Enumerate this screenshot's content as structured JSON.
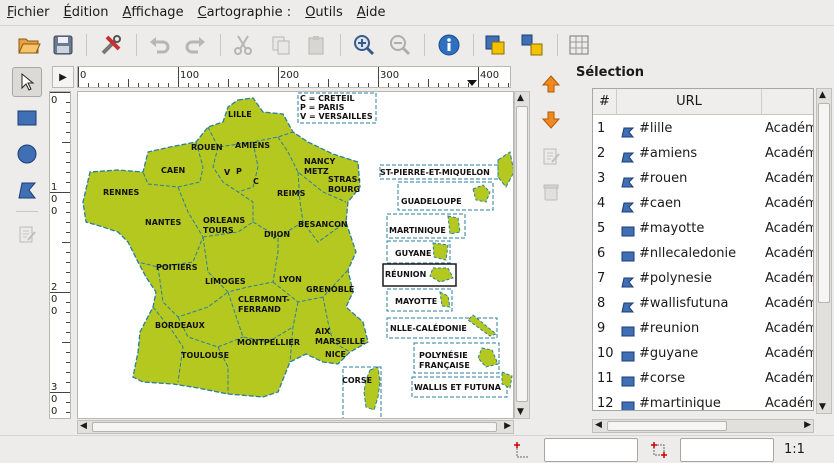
{
  "menubar": {
    "items": [
      {
        "label": "Fichier",
        "mnemonic": "F",
        "rest": "ichier"
      },
      {
        "label": "Édition",
        "mnemonic": "É",
        "rest": "dition"
      },
      {
        "label": "Affichage",
        "mnemonic": "A",
        "rest": "ffichage"
      },
      {
        "label": "Cartographie :",
        "mnemonic": "C",
        "rest": "artographie :"
      },
      {
        "label": "Outils",
        "mnemonic": "O",
        "rest": "utils"
      },
      {
        "label": "Aide",
        "mnemonic": "A",
        "rest": "ide"
      }
    ]
  },
  "rulers": {
    "h_ticks": [
      "0",
      "100",
      "200",
      "300",
      "400"
    ],
    "v_ticks": [
      "0",
      "100",
      "200",
      "300"
    ]
  },
  "map": {
    "legend": [
      "C = CRETEIL",
      "P = PARIS",
      "V = VERSAILLES"
    ],
    "regions": [
      "LILLE",
      "AMIENS",
      "ROUEN",
      "CAEN",
      "V",
      "P",
      "C",
      "NANCY METZ",
      "STRAS-BOURG",
      "REIMS",
      "RENNES",
      "NANTES",
      "ORLEANS TOURS",
      "DIJON",
      "BESANCON",
      "POITIERS",
      "LIMOGES",
      "LYON",
      "GRENOBLE",
      "CLERMONT-FERRAND",
      "BORDEAUX",
      "TOULOUSE",
      "MONTPELLIER",
      "AIX MARSEILLE",
      "NICE",
      "CORSE"
    ],
    "overseas": [
      "ST-PIERRE-ET-MIQUELON",
      "GUADELOUPE",
      "MARTINIQUE",
      "GUYANE",
      "RÉUNION",
      "MAYOTTE",
      "NLLE-CALÉDONIE",
      "POLYNÉSIE FRANÇAISE",
      "WALLIS ET FUTUNA"
    ]
  },
  "selection": {
    "title": "Sélection",
    "columns": [
      "#",
      "URL"
    ],
    "rows": [
      {
        "n": "1",
        "url": "#lille",
        "name": "Académ",
        "shape": "poly"
      },
      {
        "n": "2",
        "url": "#amiens",
        "name": "Académ",
        "shape": "poly"
      },
      {
        "n": "3",
        "url": "#rouen",
        "name": "Académ",
        "shape": "poly"
      },
      {
        "n": "4",
        "url": "#caen",
        "name": "Académ",
        "shape": "poly"
      },
      {
        "n": "5",
        "url": "#mayotte",
        "name": "Académ",
        "shape": "rect"
      },
      {
        "n": "6",
        "url": "#nllecaledonie",
        "name": "Académ",
        "shape": "rect"
      },
      {
        "n": "7",
        "url": "#polynesie",
        "name": "Académ",
        "shape": "poly"
      },
      {
        "n": "8",
        "url": "#wallisfutuna",
        "name": "Académ",
        "shape": "poly"
      },
      {
        "n": "9",
        "url": "#reunion",
        "name": "Académ",
        "shape": "rect"
      },
      {
        "n": "10",
        "url": "#guyane",
        "name": "Académ",
        "shape": "rect"
      },
      {
        "n": "11",
        "url": "#corse",
        "name": "Académ",
        "shape": "rect"
      },
      {
        "n": "12",
        "url": "#martinique",
        "name": "Académ",
        "shape": "rect"
      }
    ]
  },
  "status": {
    "zoom": "1:1",
    "position_value": "",
    "size_value": ""
  },
  "colors": {
    "land": "#b5c820",
    "land_dark": "#9aad14",
    "outline": "#2a7fa0",
    "accent_orange": "#f08a1c",
    "selection_blue": "#3f6fb5"
  }
}
